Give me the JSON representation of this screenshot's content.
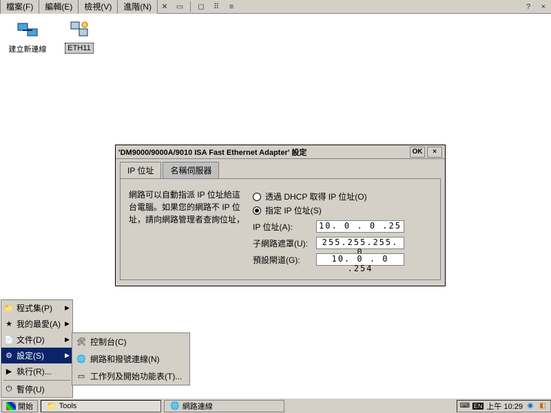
{
  "menubar": {
    "file": "檔案(F)",
    "edit": "編輯(E)",
    "view": "檢視(V)",
    "advanced": "進階(N)",
    "help": "?",
    "close": "×"
  },
  "desktop_icons": {
    "new_conn": "建立新連線",
    "eth": "ETH11"
  },
  "dialog": {
    "title": "'DM9000/9000A/9010 ISA Fast Ethernet Adapter' 設定",
    "ok": "OK",
    "close": "×",
    "tab_ip": "IP 位址",
    "tab_ns": "名稱伺服器",
    "info": "網路可以自動指派 IP 位址給這台電腦。如果您的網路不 IP 位址，請向網路管理者查詢位址，",
    "radio_dhcp": "透過 DHCP 取得 IP 位址(O)",
    "radio_manual": "指定 IP 位址(S)",
    "lbl_ip": "IP 位址(A):",
    "lbl_mask": "子網路遮罩(U):",
    "lbl_gw": "預設閘道(G):",
    "val_ip": "10. 0 . 0 .25",
    "val_mask": "255.255.255. 0",
    "val_gw": "10. 0 . 0 .254"
  },
  "startmenu": {
    "programs": "程式集(P)",
    "favorites": "我的最愛(A)",
    "documents": "文件(D)",
    "settings": "設定(S)",
    "run": "執行(R)...",
    "suspend": "暫停(U)"
  },
  "submenu": {
    "control_panel": "控制台(C)",
    "network": "網路和撥號連線(N)",
    "taskbar": "工作列及開始功能表(T)..."
  },
  "taskbar": {
    "start": "開始",
    "tools": "Tools",
    "netconn": "網路連線",
    "lang": "EN",
    "clock": "上午 10:29"
  }
}
